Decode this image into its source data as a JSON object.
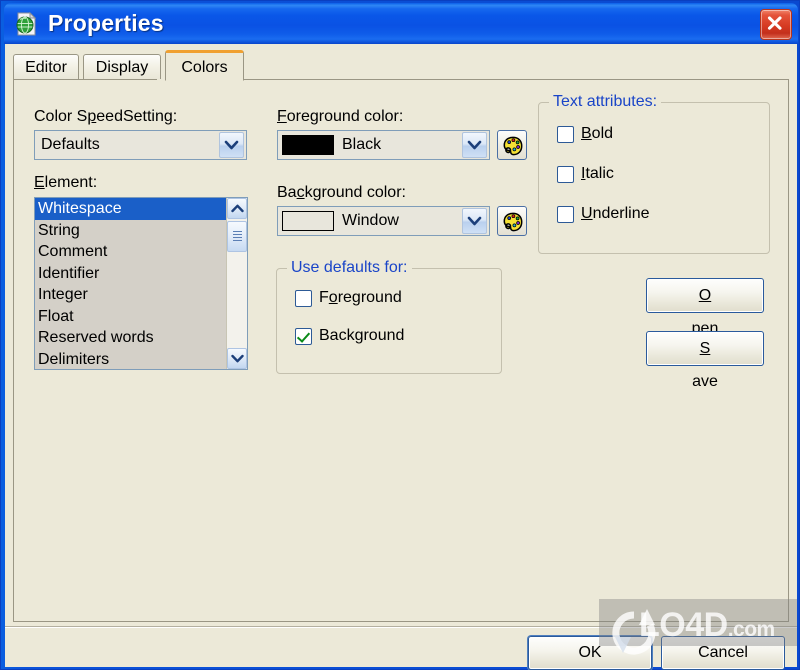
{
  "window": {
    "title": "Properties",
    "icon": "document-globe-icon",
    "close_label": "×",
    "titlebar_color": "#0a52e4",
    "client_color": "#ece9d8"
  },
  "tabs": [
    {
      "label": "Editor",
      "active": false
    },
    {
      "label": "Display",
      "active": false
    },
    {
      "label": "Colors",
      "active": true
    }
  ],
  "colors_tab": {
    "speedsetting": {
      "label_pre": "Color S",
      "label_acc": "p",
      "label_post": "eedSetting:",
      "label_full": "Color SpeedSetting:",
      "value": "Defaults"
    },
    "element": {
      "label_acc": "E",
      "label_post": "lement:",
      "label_full": "Element:",
      "items": [
        "Whitespace",
        "String",
        "Comment",
        "Identifier",
        "Integer",
        "Float",
        "Reserved words",
        "Delimiters"
      ],
      "selected": "Whitespace",
      "selected_index": 0
    },
    "foreground": {
      "label_acc": "F",
      "label_post": "oreground color:",
      "label_full": "Foreground color:",
      "value": "Black",
      "swatch_color": "#000000",
      "palette_button": "palette-icon"
    },
    "background": {
      "label_pre": "Ba",
      "label_acc": "c",
      "label_post": "kground color:",
      "label_full": "Background color:",
      "value": "Window",
      "swatch_color": "#e8e6dc",
      "palette_button": "palette-icon"
    },
    "use_defaults": {
      "legend": "Use defaults for:",
      "legend_color": "#1a45c8",
      "items": [
        {
          "label_pre": "F",
          "label_acc": "o",
          "label_post": "reground",
          "label_full": "Foreground",
          "checked": false
        },
        {
          "label_pre": "",
          "label_acc": "",
          "label_post": "Background",
          "label_full": "Background",
          "checked": true
        }
      ]
    },
    "text_attributes": {
      "legend": "Text attributes:",
      "legend_color": "#1a45c8",
      "items": [
        {
          "label_acc": "B",
          "label_post": "old",
          "label_full": "Bold",
          "checked": false
        },
        {
          "label_acc": "I",
          "label_post": "talic",
          "label_full": "Italic",
          "checked": false
        },
        {
          "label_acc": "U",
          "label_post": "nderline",
          "label_full": "Underline",
          "checked": false
        }
      ]
    },
    "side_buttons": [
      {
        "label_acc": "O",
        "label_post": "pen",
        "label_full": "Open"
      },
      {
        "label_acc": "S",
        "label_post": "ave",
        "label_full": "Save"
      }
    ]
  },
  "dialog_buttons": [
    {
      "label": "OK",
      "default": true
    },
    {
      "label": "Cancel",
      "default": false
    }
  ],
  "watermark": {
    "text": "LO4D",
    "suffix": ".com"
  }
}
